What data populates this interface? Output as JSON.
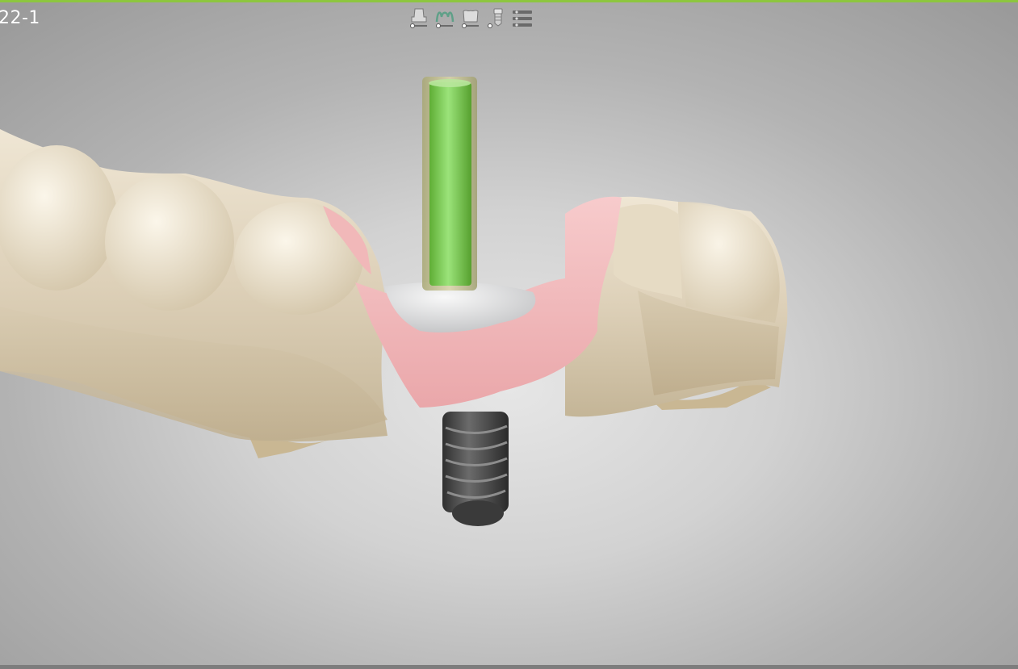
{
  "viewer": {
    "case_label": "22-1",
    "accent_color": "#8dc63f"
  },
  "toolbar": {
    "buttons": [
      {
        "icon": "abutment-icon",
        "tooltip": ""
      },
      {
        "icon": "gingiva-icon",
        "tooltip": ""
      },
      {
        "icon": "crown-icon",
        "tooltip": ""
      },
      {
        "icon": "implant-icon",
        "tooltip": ""
      },
      {
        "icon": "settings-list-icon",
        "tooltip": ""
      }
    ]
  },
  "scene": {
    "model_color": "#ddd0b8",
    "gingiva_color": "#f2b6b8",
    "screw_channel_color": "#7ccc4a",
    "abutment_color": "#dedfe0",
    "implant_color": "#4a4a4a"
  }
}
